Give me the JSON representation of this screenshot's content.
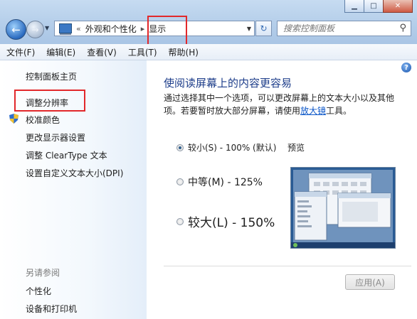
{
  "window": {
    "minimize_icon": "minimize-icon",
    "maximize_icon": "maximize-icon",
    "close_icon": "close-icon",
    "minimize_glyph": "▁",
    "maximize_glyph": "□",
    "close_glyph": "✕"
  },
  "address": {
    "breadcrumb_prefix": "«",
    "crumbs": [
      "外观和个性化",
      "显示"
    ],
    "separator": "▸",
    "refresh_glyph": "↻"
  },
  "search": {
    "placeholder": "搜索控制面板"
  },
  "menu": [
    "文件(F)",
    "编辑(E)",
    "查看(V)",
    "工具(T)",
    "帮助(H)"
  ],
  "sidebar": {
    "items": [
      "控制面板主页",
      "调整分辨率",
      "校准颜色",
      "更改显示器设置",
      "调整 ClearType 文本",
      "设置自定义文本大小(DPI)"
    ],
    "see_also_label": "另请参阅",
    "see_also_items": [
      "个性化",
      "设备和打印机"
    ]
  },
  "main": {
    "title": "使阅读屏幕上的内容更容易",
    "description_line1": "通过选择其中一个选项，可以更改屏幕上的文本大小以及其他",
    "description_line2_before": "项。若要暂时放大部分屏幕，请使用",
    "description_link": "放大镜",
    "description_line2_after": "工具。",
    "options": [
      {
        "label": "较小(S) - 100% (默认)",
        "selected": true
      },
      {
        "label": "中等(M) - 125%",
        "selected": false
      },
      {
        "label": "较大(L) - 150%",
        "selected": false
      }
    ],
    "preview_label": "预览",
    "apply_label": "应用(A)",
    "help_glyph": "?"
  },
  "colors": {
    "highlight_box": "#e2282b",
    "title_blue": "#1d3d8a",
    "link_blue": "#0b56c8"
  }
}
